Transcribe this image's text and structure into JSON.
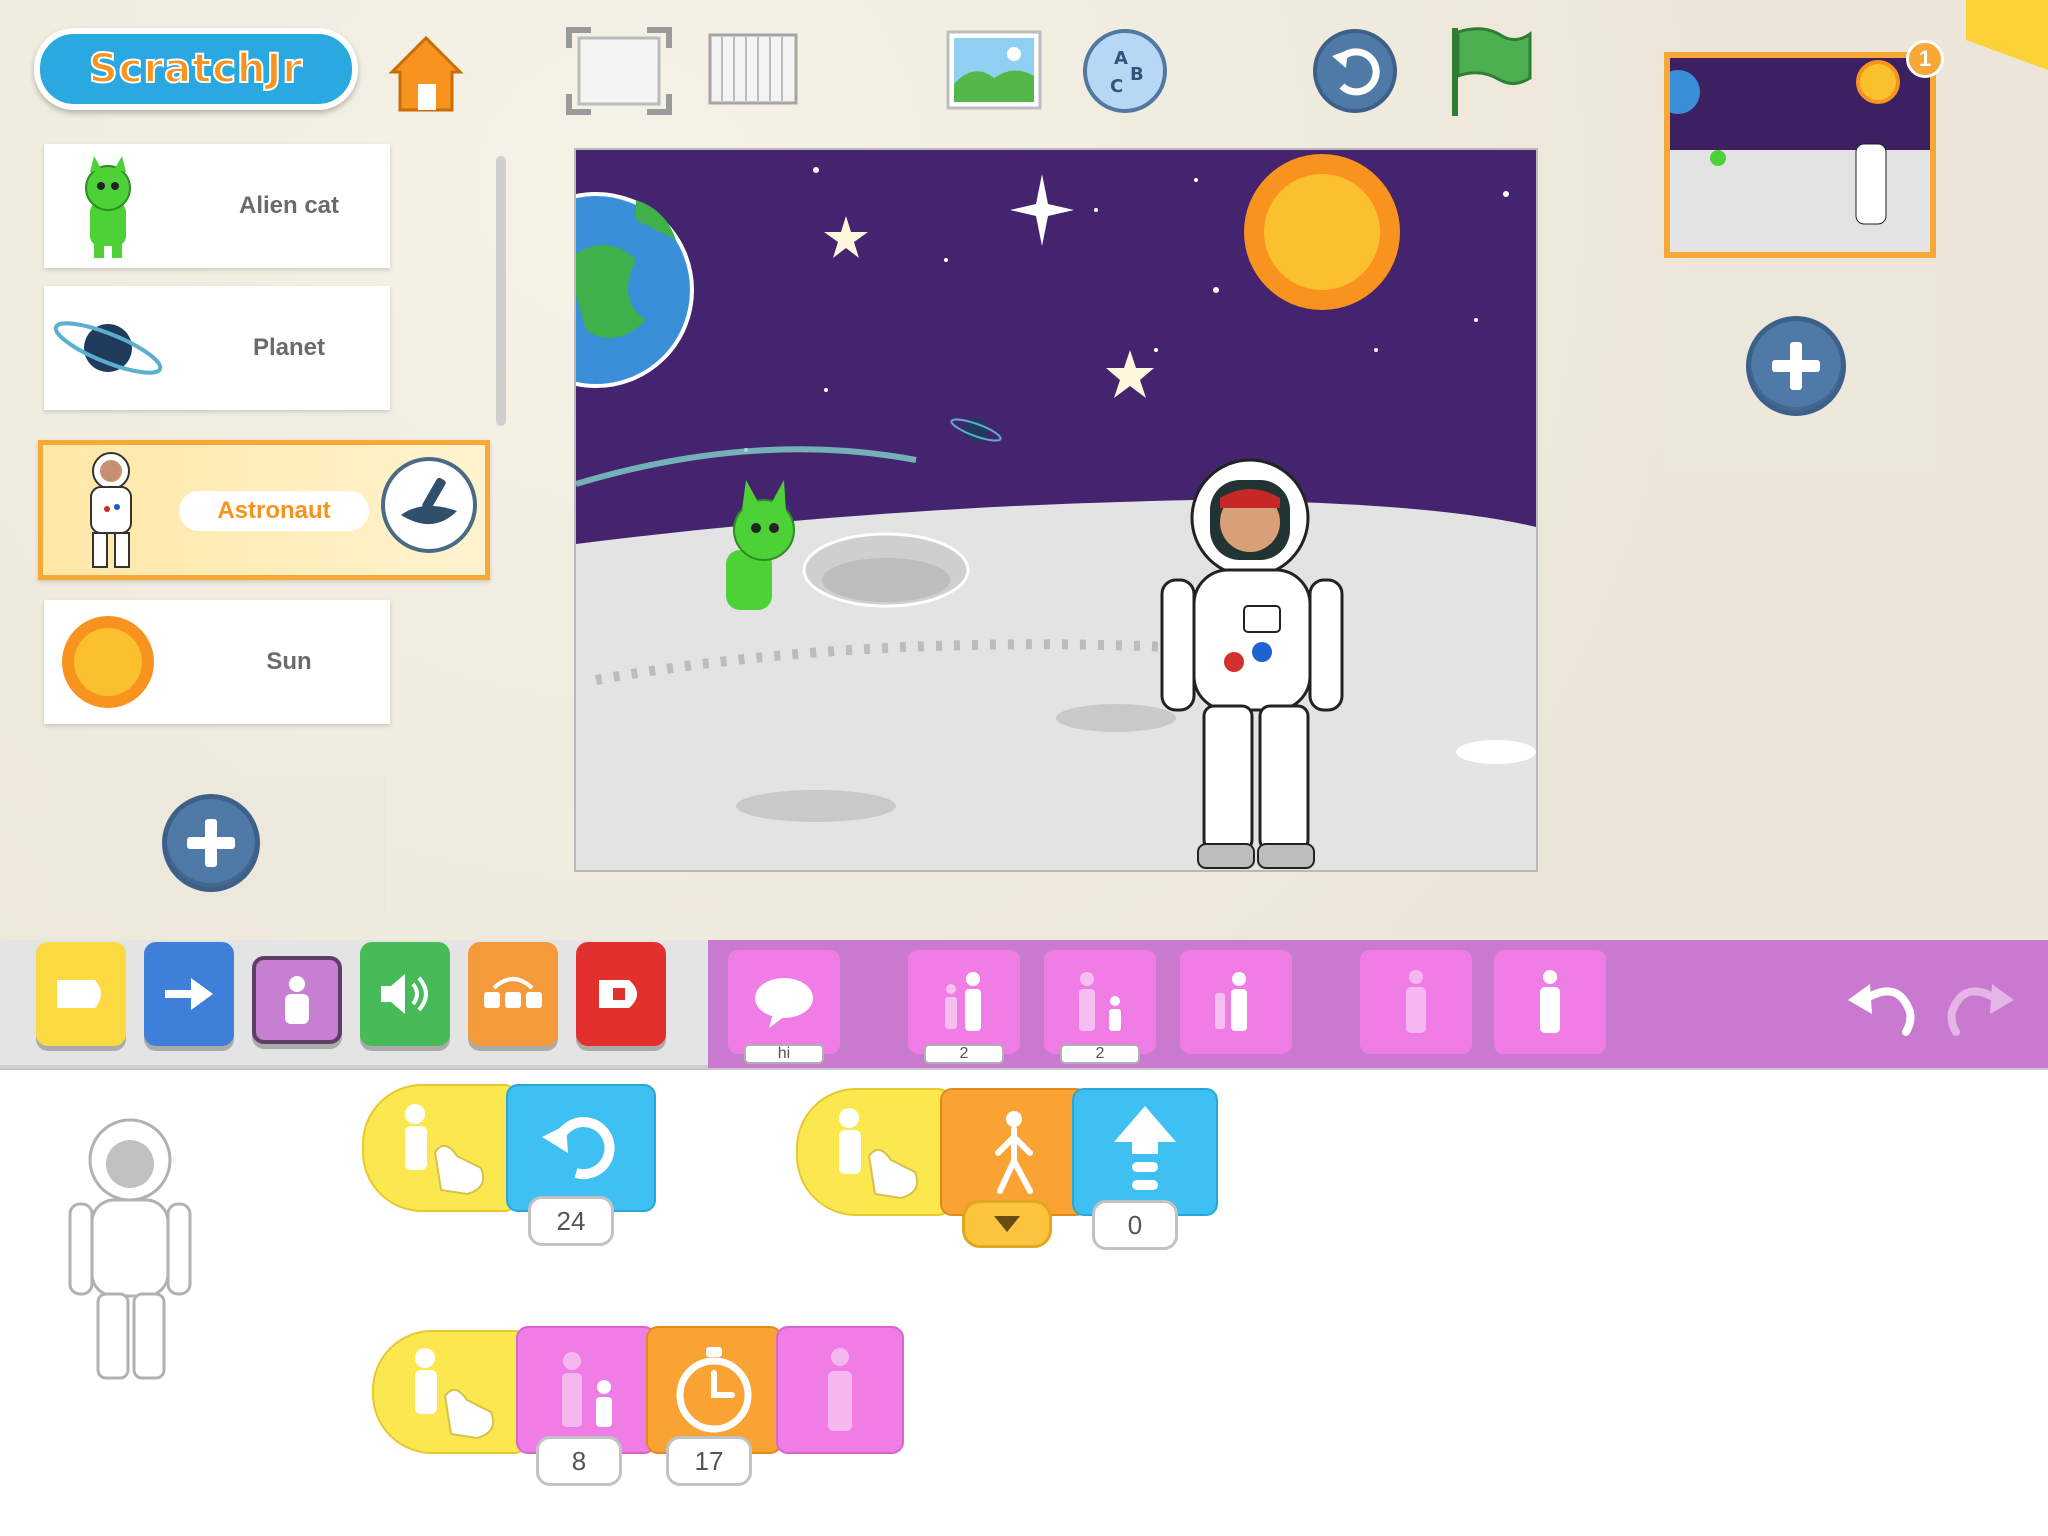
{
  "app": {
    "logo_text": "ScratchJr"
  },
  "toolbar": {
    "home": "home-icon",
    "fullscreen": "fullscreen-icon",
    "grid": "grid-icon",
    "background": "background-icon",
    "text": "abc-text-icon",
    "reset": "reset-icon",
    "green_flag": "green-flag-icon"
  },
  "sprites": [
    {
      "label": "Alien cat",
      "icon": "alien-cat-icon"
    },
    {
      "label": "Planet",
      "icon": "planet-icon"
    },
    {
      "label": "Astronaut",
      "icon": "astronaut-icon",
      "selected": true
    },
    {
      "label": "Sun",
      "icon": "sun-icon"
    }
  ],
  "pages": {
    "count_badge": "1"
  },
  "categories": [
    "triggering",
    "motion",
    "looks",
    "sound",
    "control",
    "end"
  ],
  "palette": {
    "say_arg": "hi",
    "grow_arg": "2",
    "shrink_arg": "2"
  },
  "scripts": {
    "script1": {
      "rotate_arg": "24"
    },
    "script2": {
      "up_arg": "0"
    },
    "script3": {
      "shrink_arg": "8",
      "wait_arg": "17"
    }
  },
  "colors": {
    "stage_sky": "#45246f",
    "moon_ground": "#e3e3e3",
    "selected_sprite": "#f7a836",
    "looks_category": "#c979cf",
    "trigger_block": "#fbe84e"
  }
}
